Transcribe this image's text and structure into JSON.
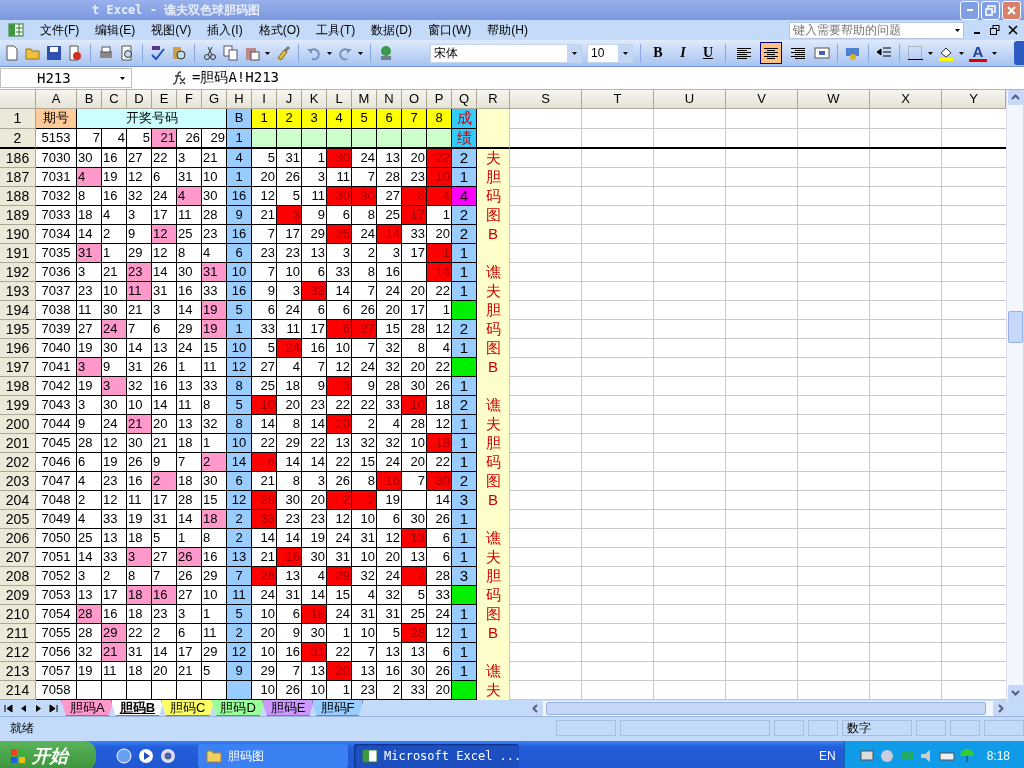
{
  "window": {
    "title": "t Excel - 谯夫双色球胆码图"
  },
  "menu": [
    "文件(F)",
    "编辑(E)",
    "视图(V)",
    "插入(I)",
    "格式(O)",
    "工具(T)",
    "数据(D)",
    "窗口(W)",
    "帮助(H)"
  ],
  "help_box": {
    "placeholder": "键入需要帮助的问题"
  },
  "toolbar": {
    "font": "宋体",
    "font_size": "10",
    "format_buttons": [
      "B",
      "I",
      "U"
    ],
    "align": [
      {
        "selected": false
      },
      {
        "selected": true
      },
      {
        "selected": false
      }
    ],
    "font_color_label": "A"
  },
  "formula_bar": {
    "name_box": "H213",
    "formula": "=胆码A!H213"
  },
  "sheet": {
    "columns": [
      "A",
      "B",
      "C",
      "D",
      "E",
      "F",
      "G",
      "H",
      "I",
      "J",
      "K",
      "L",
      "M",
      "N",
      "O",
      "P",
      "Q",
      "R",
      "S",
      "T",
      "U",
      "V",
      "W",
      "X",
      "Y"
    ],
    "header": {
      "n": "1",
      "period": "期号",
      "draw": "开奖号码",
      "blue": "B",
      "positions": [
        "1",
        "2",
        "3",
        "4",
        "5",
        "6",
        "7",
        "8"
      ],
      "score": "成"
    },
    "summary": {
      "n": "2",
      "period": "5153",
      "draw": [
        {
          "v": "7",
          "hit": false
        },
        {
          "v": "4",
          "hit": false
        },
        {
          "v": "5",
          "hit": false
        },
        {
          "v": "21",
          "hit": true
        },
        {
          "v": "26",
          "hit": false
        },
        {
          "v": "29",
          "hit": false
        }
      ],
      "blue": "1",
      "score": "绩"
    },
    "rows": [
      {
        "n": "186",
        "period": "7030",
        "draw": [
          {
            "v": "30",
            "hit": false
          },
          {
            "v": "16",
            "hit": false
          },
          {
            "v": "27",
            "hit": false
          },
          {
            "v": "22",
            "hit": false
          },
          {
            "v": "3",
            "hit": false
          },
          {
            "v": "21",
            "hit": false
          }
        ],
        "blue": "4",
        "pos": [
          {
            "v": "5",
            "hit": false
          },
          {
            "v": "31",
            "hit": false
          },
          {
            "v": "1",
            "hit": false
          },
          {
            "v": "30",
            "hit": true
          },
          {
            "v": "24",
            "hit": false
          },
          {
            "v": "13",
            "hit": false
          },
          {
            "v": "20",
            "hit": false
          },
          {
            "v": "22",
            "hit": true
          }
        ],
        "result": {
          "value": "2",
          "color": "#99ccff"
        },
        "side": "夫"
      },
      {
        "n": "187",
        "period": "7031",
        "draw": [
          {
            "v": "4",
            "hit": true
          },
          {
            "v": "19",
            "hit": false
          },
          {
            "v": "12",
            "hit": false
          },
          {
            "v": "6",
            "hit": false
          },
          {
            "v": "31",
            "hit": false
          },
          {
            "v": "10",
            "hit": false
          }
        ],
        "blue": "1",
        "pos": [
          {
            "v": "20",
            "hit": false
          },
          {
            "v": "26",
            "hit": false
          },
          {
            "v": "3",
            "hit": false
          },
          {
            "v": "11",
            "hit": false
          },
          {
            "v": "7",
            "hit": false
          },
          {
            "v": "28",
            "hit": false
          },
          {
            "v": "23",
            "hit": false
          },
          {
            "v": "10",
            "hit": true
          }
        ],
        "result": {
          "value": "1",
          "color": "#99ccff"
        },
        "side": "胆"
      },
      {
        "n": "188",
        "period": "7032",
        "draw": [
          {
            "v": "8",
            "hit": false
          },
          {
            "v": "16",
            "hit": false
          },
          {
            "v": "32",
            "hit": false
          },
          {
            "v": "24",
            "hit": false
          },
          {
            "v": "4",
            "hit": true
          },
          {
            "v": "30",
            "hit": false
          }
        ],
        "blue": "16",
        "pos": [
          {
            "v": "12",
            "hit": false
          },
          {
            "v": "5",
            "hit": false
          },
          {
            "v": "11",
            "hit": false
          },
          {
            "v": "30",
            "hit": true
          },
          {
            "v": "30",
            "hit": true
          },
          {
            "v": "27",
            "hit": false
          },
          {
            "v": "8",
            "hit": true
          },
          {
            "v": "4",
            "hit": true
          }
        ],
        "result": {
          "value": "4",
          "color": "#ff00ff"
        },
        "side": "码"
      },
      {
        "n": "189",
        "period": "7033",
        "draw": [
          {
            "v": "18",
            "hit": false
          },
          {
            "v": "4",
            "hit": false
          },
          {
            "v": "3",
            "hit": false
          },
          {
            "v": "17",
            "hit": false
          },
          {
            "v": "11",
            "hit": false
          },
          {
            "v": "28",
            "hit": false
          }
        ],
        "blue": "9",
        "pos": [
          {
            "v": "21",
            "hit": false
          },
          {
            "v": "3",
            "hit": true
          },
          {
            "v": "9",
            "hit": false
          },
          {
            "v": "6",
            "hit": false
          },
          {
            "v": "8",
            "hit": false
          },
          {
            "v": "25",
            "hit": false
          },
          {
            "v": "17",
            "hit": true
          },
          {
            "v": "1",
            "hit": false
          }
        ],
        "result": {
          "value": "2",
          "color": "#99ccff"
        },
        "side": "图"
      },
      {
        "n": "190",
        "period": "7034",
        "draw": [
          {
            "v": "14",
            "hit": false
          },
          {
            "v": "2",
            "hit": false
          },
          {
            "v": "9",
            "hit": false
          },
          {
            "v": "12",
            "hit": true
          },
          {
            "v": "25",
            "hit": false
          },
          {
            "v": "23",
            "hit": false
          }
        ],
        "blue": "16",
        "pos": [
          {
            "v": "7",
            "hit": false
          },
          {
            "v": "17",
            "hit": false
          },
          {
            "v": "29",
            "hit": false
          },
          {
            "v": "25",
            "hit": true
          },
          {
            "v": "24",
            "hit": false
          },
          {
            "v": "14",
            "hit": true
          },
          {
            "v": "33",
            "hit": false
          },
          {
            "v": "20",
            "hit": false
          }
        ],
        "result": {
          "value": "2",
          "color": "#99ccff"
        },
        "side": "B"
      },
      {
        "n": "191",
        "period": "7035",
        "draw": [
          {
            "v": "31",
            "hit": true
          },
          {
            "v": "1",
            "hit": false
          },
          {
            "v": "29",
            "hit": false
          },
          {
            "v": "12",
            "hit": false
          },
          {
            "v": "8",
            "hit": false
          },
          {
            "v": "4",
            "hit": false
          }
        ],
        "blue": "6",
        "pos": [
          {
            "v": "23",
            "hit": false
          },
          {
            "v": "23",
            "hit": false
          },
          {
            "v": "13",
            "hit": false
          },
          {
            "v": "3",
            "hit": false
          },
          {
            "v": "2",
            "hit": false
          },
          {
            "v": "3",
            "hit": false
          },
          {
            "v": "17",
            "hit": false
          },
          {
            "v": "1",
            "hit": true
          }
        ],
        "result": {
          "value": "1",
          "color": "#99ccff"
        }
      },
      {
        "n": "192",
        "period": "7036",
        "draw": [
          {
            "v": "3",
            "hit": false
          },
          {
            "v": "21",
            "hit": false
          },
          {
            "v": "23",
            "hit": true
          },
          {
            "v": "14",
            "hit": false
          },
          {
            "v": "30",
            "hit": false
          },
          {
            "v": "31",
            "hit": true
          }
        ],
        "blue": "10",
        "pos": [
          {
            "v": "7",
            "hit": false
          },
          {
            "v": "10",
            "hit": false
          },
          {
            "v": "6",
            "hit": false
          },
          {
            "v": "33",
            "hit": false
          },
          {
            "v": "8",
            "hit": false
          },
          {
            "v": "16",
            "hit": false
          },
          {
            "hit": false
          },
          {
            "v": "14",
            "hit": true
          }
        ],
        "result": {
          "value": "1",
          "color": "#99ccff"
        },
        "side": "谯"
      },
      {
        "n": "193",
        "period": "7037",
        "draw": [
          {
            "v": "23",
            "hit": false
          },
          {
            "v": "10",
            "hit": false
          },
          {
            "v": "11",
            "hit": true
          },
          {
            "v": "31",
            "hit": false
          },
          {
            "v": "16",
            "hit": false
          },
          {
            "v": "33",
            "hit": false
          }
        ],
        "blue": "16",
        "pos": [
          {
            "v": "9",
            "hit": false
          },
          {
            "v": "3",
            "hit": false
          },
          {
            "v": "33",
            "hit": true
          },
          {
            "v": "14",
            "hit": false
          },
          {
            "v": "7",
            "hit": false
          },
          {
            "v": "24",
            "hit": false
          },
          {
            "v": "20",
            "hit": false
          },
          {
            "v": "22",
            "hit": false
          }
        ],
        "result": {
          "value": "1",
          "color": "#99ccff"
        },
        "side": "夫"
      },
      {
        "n": "194",
        "period": "7038",
        "draw": [
          {
            "v": "11",
            "hit": false
          },
          {
            "v": "30",
            "hit": false
          },
          {
            "v": "21",
            "hit": false
          },
          {
            "v": "3",
            "hit": false
          },
          {
            "v": "14",
            "hit": false
          },
          {
            "v": "19",
            "hit": true
          }
        ],
        "blue": "5",
        "pos": [
          {
            "v": "6",
            "hit": false
          },
          {
            "v": "24",
            "hit": false
          },
          {
            "v": "6",
            "hit": false
          },
          {
            "v": "6",
            "hit": false
          },
          {
            "v": "26",
            "hit": false
          },
          {
            "v": "20",
            "hit": false
          },
          {
            "v": "17",
            "hit": false
          },
          {
            "v": "1",
            "hit": false
          }
        ],
        "result": {
          "color": "#00ee00"
        },
        "side": "胆"
      },
      {
        "n": "195",
        "period": "7039",
        "draw": [
          {
            "v": "27",
            "hit": false
          },
          {
            "v": "24",
            "hit": true
          },
          {
            "v": "7",
            "hit": false
          },
          {
            "v": "6",
            "hit": false
          },
          {
            "v": "29",
            "hit": false
          },
          {
            "v": "19",
            "hit": true
          }
        ],
        "blue": "1",
        "pos": [
          {
            "v": "33",
            "hit": false
          },
          {
            "v": "11",
            "hit": false
          },
          {
            "v": "17",
            "hit": false
          },
          {
            "v": "6",
            "hit": true
          },
          {
            "v": "27",
            "hit": true
          },
          {
            "v": "15",
            "hit": false
          },
          {
            "v": "28",
            "hit": false
          },
          {
            "v": "12",
            "hit": false
          }
        ],
        "result": {
          "value": "2",
          "color": "#99ccff"
        },
        "side": "码"
      },
      {
        "n": "196",
        "period": "7040",
        "draw": [
          {
            "v": "19",
            "hit": false
          },
          {
            "v": "30",
            "hit": false
          },
          {
            "v": "14",
            "hit": false
          },
          {
            "v": "13",
            "hit": false
          },
          {
            "v": "24",
            "hit": false
          },
          {
            "v": "15",
            "hit": false
          }
        ],
        "blue": "10",
        "pos": [
          {
            "v": "5",
            "hit": false
          },
          {
            "v": "24",
            "hit": true
          },
          {
            "v": "16",
            "hit": false
          },
          {
            "v": "10",
            "hit": false
          },
          {
            "v": "7",
            "hit": false
          },
          {
            "v": "32",
            "hit": false
          },
          {
            "v": "8",
            "hit": false
          },
          {
            "v": "4",
            "hit": false
          }
        ],
        "result": {
          "value": "1",
          "color": "#99ccff"
        },
        "side": "图"
      },
      {
        "n": "197",
        "period": "7041",
        "draw": [
          {
            "v": "3",
            "hit": true
          },
          {
            "v": "9",
            "hit": false
          },
          {
            "v": "31",
            "hit": false
          },
          {
            "v": "26",
            "hit": false
          },
          {
            "v": "1",
            "hit": false
          },
          {
            "v": "11",
            "hit": false
          }
        ],
        "blue": "12",
        "pos": [
          {
            "v": "27",
            "hit": false
          },
          {
            "v": "4",
            "hit": false
          },
          {
            "v": "7",
            "hit": false
          },
          {
            "v": "12",
            "hit": false
          },
          {
            "v": "24",
            "hit": false
          },
          {
            "v": "32",
            "hit": false
          },
          {
            "v": "20",
            "hit": false
          },
          {
            "v": "22",
            "hit": false
          }
        ],
        "result": {
          "color": "#00ee00"
        },
        "side": "B"
      },
      {
        "n": "198",
        "period": "7042",
        "draw": [
          {
            "v": "19",
            "hit": false
          },
          {
            "v": "3",
            "hit": true
          },
          {
            "v": "32",
            "hit": false
          },
          {
            "v": "16",
            "hit": false
          },
          {
            "v": "13",
            "hit": false
          },
          {
            "v": "33",
            "hit": false
          }
        ],
        "blue": "8",
        "pos": [
          {
            "v": "25",
            "hit": false
          },
          {
            "v": "18",
            "hit": false
          },
          {
            "v": "9",
            "hit": false
          },
          {
            "v": "3",
            "hit": true
          },
          {
            "v": "9",
            "hit": false
          },
          {
            "v": "28",
            "hit": false
          },
          {
            "v": "30",
            "hit": false
          },
          {
            "v": "26",
            "hit": false
          }
        ],
        "result": {
          "value": "1",
          "color": "#99ccff"
        }
      },
      {
        "n": "199",
        "period": "7043",
        "draw": [
          {
            "v": "3",
            "hit": false
          },
          {
            "v": "30",
            "hit": false
          },
          {
            "v": "10",
            "hit": false
          },
          {
            "v": "14",
            "hit": false
          },
          {
            "v": "11",
            "hit": false
          },
          {
            "v": "8",
            "hit": false
          }
        ],
        "blue": "5",
        "pos": [
          {
            "v": "10",
            "hit": true
          },
          {
            "v": "20",
            "hit": false
          },
          {
            "v": "23",
            "hit": false
          },
          {
            "v": "22",
            "hit": false
          },
          {
            "v": "22",
            "hit": false
          },
          {
            "v": "33",
            "hit": false
          },
          {
            "v": "10",
            "hit": true
          },
          {
            "v": "18",
            "hit": false
          }
        ],
        "result": {
          "value": "2",
          "color": "#99ccff"
        },
        "side": "谯"
      },
      {
        "n": "200",
        "period": "7044",
        "draw": [
          {
            "v": "9",
            "hit": false
          },
          {
            "v": "24",
            "hit": false
          },
          {
            "v": "21",
            "hit": true
          },
          {
            "v": "20",
            "hit": false
          },
          {
            "v": "13",
            "hit": false
          },
          {
            "v": "32",
            "hit": false
          }
        ],
        "blue": "8",
        "pos": [
          {
            "v": "14",
            "hit": false
          },
          {
            "v": "8",
            "hit": false
          },
          {
            "v": "14",
            "hit": false
          },
          {
            "v": "20",
            "hit": true
          },
          {
            "v": "2",
            "hit": false
          },
          {
            "v": "4",
            "hit": false
          },
          {
            "v": "28",
            "hit": false
          },
          {
            "v": "12",
            "hit": false
          }
        ],
        "result": {
          "value": "1",
          "color": "#99ccff"
        },
        "side": "夫"
      },
      {
        "n": "201",
        "period": "7045",
        "draw": [
          {
            "v": "28",
            "hit": false
          },
          {
            "v": "12",
            "hit": false
          },
          {
            "v": "30",
            "hit": false
          },
          {
            "v": "21",
            "hit": false
          },
          {
            "v": "18",
            "hit": false
          },
          {
            "v": "1",
            "hit": false
          }
        ],
        "blue": "10",
        "pos": [
          {
            "v": "22",
            "hit": false
          },
          {
            "v": "29",
            "hit": false
          },
          {
            "v": "22",
            "hit": false
          },
          {
            "v": "13",
            "hit": false
          },
          {
            "v": "32",
            "hit": false
          },
          {
            "v": "32",
            "hit": false
          },
          {
            "v": "10",
            "hit": false
          },
          {
            "v": "18",
            "hit": true
          }
        ],
        "result": {
          "value": "1",
          "color": "#99ccff"
        },
        "side": "胆"
      },
      {
        "n": "202",
        "period": "7046",
        "draw": [
          {
            "v": "6",
            "hit": false
          },
          {
            "v": "19",
            "hit": false
          },
          {
            "v": "26",
            "hit": false
          },
          {
            "v": "9",
            "hit": false
          },
          {
            "v": "7",
            "hit": false
          },
          {
            "v": "2",
            "hit": true
          }
        ],
        "blue": "14",
        "pos": [
          {
            "v": "6",
            "hit": true
          },
          {
            "v": "14",
            "hit": false
          },
          {
            "v": "14",
            "hit": false
          },
          {
            "v": "22",
            "hit": false
          },
          {
            "v": "15",
            "hit": false
          },
          {
            "v": "24",
            "hit": false
          },
          {
            "v": "20",
            "hit": false
          },
          {
            "v": "22",
            "hit": false
          }
        ],
        "result": {
          "value": "1",
          "color": "#99ccff"
        },
        "side": "码"
      },
      {
        "n": "203",
        "period": "7047",
        "draw": [
          {
            "v": "4",
            "hit": false
          },
          {
            "v": "23",
            "hit": false
          },
          {
            "v": "16",
            "hit": false
          },
          {
            "v": "2",
            "hit": true
          },
          {
            "v": "18",
            "hit": false
          },
          {
            "v": "30",
            "hit": false
          }
        ],
        "blue": "6",
        "pos": [
          {
            "v": "21",
            "hit": false
          },
          {
            "v": "8",
            "hit": false
          },
          {
            "v": "3",
            "hit": false
          },
          {
            "v": "26",
            "hit": false
          },
          {
            "v": "8",
            "hit": false
          },
          {
            "v": "16",
            "hit": true
          },
          {
            "v": "7",
            "hit": false
          },
          {
            "v": "30",
            "hit": true
          }
        ],
        "result": {
          "value": "2",
          "color": "#99ccff"
        },
        "side": "图"
      },
      {
        "n": "204",
        "period": "7048",
        "draw": [
          {
            "v": "2",
            "hit": false
          },
          {
            "v": "12",
            "hit": false
          },
          {
            "v": "11",
            "hit": false
          },
          {
            "v": "17",
            "hit": false
          },
          {
            "v": "28",
            "hit": false
          },
          {
            "v": "15",
            "hit": false
          }
        ],
        "blue": "12",
        "pos": [
          {
            "v": "28",
            "hit": true
          },
          {
            "v": "30",
            "hit": false
          },
          {
            "v": "20",
            "hit": false
          },
          {
            "v": "2",
            "hit": true
          },
          {
            "v": "2",
            "hit": true
          },
          {
            "v": "19",
            "hit": false
          },
          {
            "hit": false
          },
          {
            "v": "14",
            "hit": false
          }
        ],
        "result": {
          "value": "3",
          "color": "#99ccff"
        },
        "side": "B"
      },
      {
        "n": "205",
        "period": "7049",
        "draw": [
          {
            "v": "4",
            "hit": false
          },
          {
            "v": "33",
            "hit": false
          },
          {
            "v": "19",
            "hit": false
          },
          {
            "v": "31",
            "hit": false
          },
          {
            "v": "14",
            "hit": false
          },
          {
            "v": "18",
            "hit": true
          }
        ],
        "blue": "2",
        "pos": [
          {
            "v": "33",
            "hit": true
          },
          {
            "v": "23",
            "hit": false
          },
          {
            "v": "23",
            "hit": false
          },
          {
            "v": "12",
            "hit": false
          },
          {
            "v": "10",
            "hit": false
          },
          {
            "v": "6",
            "hit": false
          },
          {
            "v": "30",
            "hit": false
          },
          {
            "v": "26",
            "hit": false
          }
        ],
        "result": {
          "value": "1",
          "color": "#99ccff"
        }
      },
      {
        "n": "206",
        "period": "7050",
        "draw": [
          {
            "v": "25",
            "hit": false
          },
          {
            "v": "13",
            "hit": false
          },
          {
            "v": "18",
            "hit": false
          },
          {
            "v": "5",
            "hit": false
          },
          {
            "v": "1",
            "hit": false
          },
          {
            "v": "8",
            "hit": false
          }
        ],
        "blue": "2",
        "pos": [
          {
            "v": "14",
            "hit": false
          },
          {
            "v": "14",
            "hit": false
          },
          {
            "v": "19",
            "hit": false
          },
          {
            "v": "24",
            "hit": false
          },
          {
            "v": "31",
            "hit": false
          },
          {
            "v": "12",
            "hit": false
          },
          {
            "v": "13",
            "hit": true
          },
          {
            "v": "6",
            "hit": false
          }
        ],
        "result": {
          "value": "1",
          "color": "#99ccff"
        },
        "side": "谯"
      },
      {
        "n": "207",
        "period": "7051",
        "draw": [
          {
            "v": "14",
            "hit": false
          },
          {
            "v": "33",
            "hit": false
          },
          {
            "v": "3",
            "hit": true
          },
          {
            "v": "27",
            "hit": false
          },
          {
            "v": "26",
            "hit": true
          },
          {
            "v": "16",
            "hit": false
          }
        ],
        "blue": "13",
        "pos": [
          {
            "v": "21",
            "hit": false
          },
          {
            "v": "16",
            "hit": true
          },
          {
            "v": "30",
            "hit": false
          },
          {
            "v": "31",
            "hit": false
          },
          {
            "v": "10",
            "hit": false
          },
          {
            "v": "20",
            "hit": false
          },
          {
            "v": "13",
            "hit": false
          },
          {
            "v": "6",
            "hit": false
          }
        ],
        "result": {
          "value": "1",
          "color": "#99ccff"
        },
        "side": "夫"
      },
      {
        "n": "208",
        "period": "7052",
        "draw": [
          {
            "v": "3",
            "hit": false
          },
          {
            "v": "2",
            "hit": false
          },
          {
            "v": "8",
            "hit": false
          },
          {
            "v": "7",
            "hit": false
          },
          {
            "v": "26",
            "hit": false
          },
          {
            "v": "29",
            "hit": false
          }
        ],
        "blue": "7",
        "pos": [
          {
            "v": "26",
            "hit": true
          },
          {
            "v": "13",
            "hit": false
          },
          {
            "v": "4",
            "hit": false
          },
          {
            "v": "29",
            "hit": true
          },
          {
            "v": "32",
            "hit": false
          },
          {
            "v": "24",
            "hit": false
          },
          {
            "v": "2",
            "hit": true
          },
          {
            "v": "28",
            "hit": false
          }
        ],
        "result": {
          "value": "3",
          "color": "#99ccff"
        },
        "side": "胆"
      },
      {
        "n": "209",
        "period": "7053",
        "draw": [
          {
            "v": "13",
            "hit": false
          },
          {
            "v": "17",
            "hit": false
          },
          {
            "v": "18",
            "hit": true
          },
          {
            "v": "16",
            "hit": true
          },
          {
            "v": "27",
            "hit": false
          },
          {
            "v": "10",
            "hit": false
          }
        ],
        "blue": "11",
        "pos": [
          {
            "v": "24",
            "hit": false
          },
          {
            "v": "31",
            "hit": false
          },
          {
            "v": "14",
            "hit": false
          },
          {
            "v": "15",
            "hit": false
          },
          {
            "v": "4",
            "hit": false
          },
          {
            "v": "32",
            "hit": false
          },
          {
            "v": "5",
            "hit": false
          },
          {
            "v": "33",
            "hit": false
          }
        ],
        "result": {
          "color": "#00ee00"
        },
        "side": "码"
      },
      {
        "n": "210",
        "period": "7054",
        "draw": [
          {
            "v": "28",
            "hit": true
          },
          {
            "v": "16",
            "hit": false
          },
          {
            "v": "18",
            "hit": false
          },
          {
            "v": "23",
            "hit": false
          },
          {
            "v": "3",
            "hit": false
          },
          {
            "v": "1",
            "hit": false
          }
        ],
        "blue": "5",
        "pos": [
          {
            "v": "10",
            "hit": false
          },
          {
            "v": "6",
            "hit": false
          },
          {
            "v": "18",
            "hit": true
          },
          {
            "v": "24",
            "hit": false
          },
          {
            "v": "31",
            "hit": false
          },
          {
            "v": "31",
            "hit": false
          },
          {
            "v": "25",
            "hit": false
          },
          {
            "v": "24",
            "hit": false
          }
        ],
        "result": {
          "value": "1",
          "color": "#99ccff"
        },
        "side": "图"
      },
      {
        "n": "211",
        "period": "7055",
        "draw": [
          {
            "v": "28",
            "hit": false
          },
          {
            "v": "29",
            "hit": true
          },
          {
            "v": "22",
            "hit": false
          },
          {
            "v": "2",
            "hit": false
          },
          {
            "v": "6",
            "hit": false
          },
          {
            "v": "11",
            "hit": false
          }
        ],
        "blue": "2",
        "pos": [
          {
            "v": "20",
            "hit": false
          },
          {
            "v": "9",
            "hit": false
          },
          {
            "v": "30",
            "hit": false
          },
          {
            "v": "1",
            "hit": false
          },
          {
            "v": "10",
            "hit": false
          },
          {
            "v": "5",
            "hit": false
          },
          {
            "v": "28",
            "hit": true
          },
          {
            "v": "12",
            "hit": false
          }
        ],
        "result": {
          "value": "1",
          "color": "#99ccff"
        },
        "side": "B"
      },
      {
        "n": "212",
        "period": "7056",
        "draw": [
          {
            "v": "32",
            "hit": false
          },
          {
            "v": "21",
            "hit": true
          },
          {
            "v": "31",
            "hit": false
          },
          {
            "v": "14",
            "hit": false
          },
          {
            "v": "17",
            "hit": false
          },
          {
            "v": "29",
            "hit": false
          }
        ],
        "blue": "12",
        "pos": [
          {
            "v": "10",
            "hit": false
          },
          {
            "v": "16",
            "hit": false
          },
          {
            "v": "31",
            "hit": true
          },
          {
            "v": "22",
            "hit": false
          },
          {
            "v": "7",
            "hit": false
          },
          {
            "v": "13",
            "hit": false
          },
          {
            "v": "13",
            "hit": false
          },
          {
            "v": "6",
            "hit": false
          }
        ],
        "result": {
          "value": "1",
          "color": "#99ccff"
        }
      },
      {
        "n": "213",
        "period": "7057",
        "draw": [
          {
            "v": "19",
            "hit": false
          },
          {
            "v": "11",
            "hit": false
          },
          {
            "v": "18",
            "hit": false
          },
          {
            "v": "20",
            "hit": false
          },
          {
            "v": "21",
            "hit": false
          },
          {
            "v": "5",
            "hit": false
          }
        ],
        "blue": "9",
        "pos": [
          {
            "v": "29",
            "hit": false
          },
          {
            "v": "7",
            "hit": false
          },
          {
            "v": "13",
            "hit": false
          },
          {
            "v": "20",
            "hit": true
          },
          {
            "v": "13",
            "hit": false
          },
          {
            "v": "16",
            "hit": false
          },
          {
            "v": "30",
            "hit": false
          },
          {
            "v": "26",
            "hit": false
          }
        ],
        "result": {
          "value": "1",
          "color": "#99ccff"
        },
        "side": "谯"
      },
      {
        "n": "214",
        "period": "7058",
        "pos": [
          {
            "v": "10",
            "hit": false
          },
          {
            "v": "26",
            "hit": false
          },
          {
            "v": "10",
            "hit": false
          },
          {
            "v": "1",
            "hit": false
          },
          {
            "v": "23",
            "hit": false
          },
          {
            "v": "2",
            "hit": false
          },
          {
            "v": "33",
            "hit": false
          },
          {
            "v": "20",
            "hit": false
          }
        ],
        "result": {
          "color": "#00ee00"
        },
        "side": "夫"
      }
    ]
  },
  "sheet_tabs": [
    {
      "label": "胆码A",
      "color": "#ff99cc",
      "selected": false
    },
    {
      "label": "胆码B",
      "selected": true
    },
    {
      "label": "胆码C",
      "color": "#ffff66",
      "selected": false
    },
    {
      "label": "胆码D",
      "color": "#99ff99",
      "selected": false
    },
    {
      "label": "胆码E",
      "color": "#cc99ff",
      "selected": false
    },
    {
      "label": "胆码F",
      "color": "#99ccff",
      "selected": false
    }
  ],
  "status_bar": {
    "status": "就绪",
    "mode": "数字"
  },
  "taskbar": {
    "start": "开始",
    "windows": [
      {
        "label": "胆码图",
        "kind": "folder",
        "selected": false
      },
      {
        "label": "Microsoft Excel ...",
        "kind": "excel",
        "selected": true
      }
    ],
    "language": "EN",
    "clock": "8:18"
  }
}
